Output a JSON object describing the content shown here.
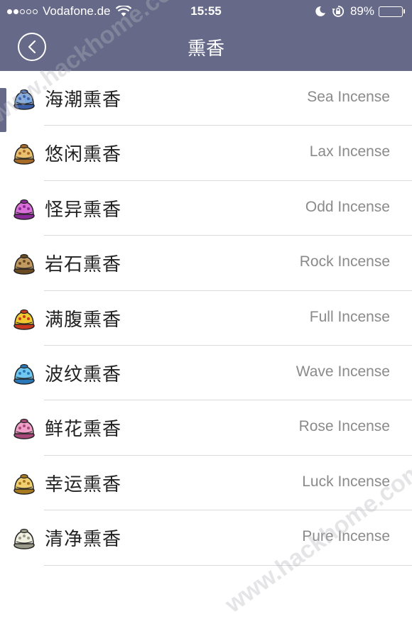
{
  "status_bar": {
    "carrier": "Vodafone.de",
    "time": "15:55",
    "battery": "89%",
    "battery_level": 0.89
  },
  "nav": {
    "title": "熏香"
  },
  "items": [
    {
      "cn": "海潮熏香",
      "en": "Sea Incense",
      "icon": "sea-incense-icon",
      "colors": [
        "#7aa8e0",
        "#3b5fa8"
      ]
    },
    {
      "cn": "悠闲熏香",
      "en": "Lax Incense",
      "icon": "lax-incense-icon",
      "colors": [
        "#e8c070",
        "#a86a28"
      ]
    },
    {
      "cn": "怪异熏香",
      "en": "Odd Incense",
      "icon": "odd-incense-icon",
      "colors": [
        "#d870d8",
        "#8a2a98"
      ]
    },
    {
      "cn": "岩石熏香",
      "en": "Rock Incense",
      "icon": "rock-incense-icon",
      "colors": [
        "#c09a60",
        "#6a4a20"
      ]
    },
    {
      "cn": "满腹熏香",
      "en": "Full Incense",
      "icon": "full-incense-icon",
      "colors": [
        "#f0c830",
        "#c83a20"
      ]
    },
    {
      "cn": "波纹熏香",
      "en": "Wave Incense",
      "icon": "wave-incense-icon",
      "colors": [
        "#70c8f0",
        "#2a78b8"
      ]
    },
    {
      "cn": "鲜花熏香",
      "en": "Rose Incense",
      "icon": "rose-incense-icon",
      "colors": [
        "#f0a0c8",
        "#a84878"
      ]
    },
    {
      "cn": "幸运熏香",
      "en": "Luck Incense",
      "icon": "luck-incense-icon",
      "colors": [
        "#f0d070",
        "#a87a20"
      ]
    },
    {
      "cn": "清净熏香",
      "en": "Pure Incense",
      "icon": "pure-incense-icon",
      "colors": [
        "#f0f0e0",
        "#9a9a8a"
      ]
    }
  ],
  "watermark": "www.hackhome.com"
}
